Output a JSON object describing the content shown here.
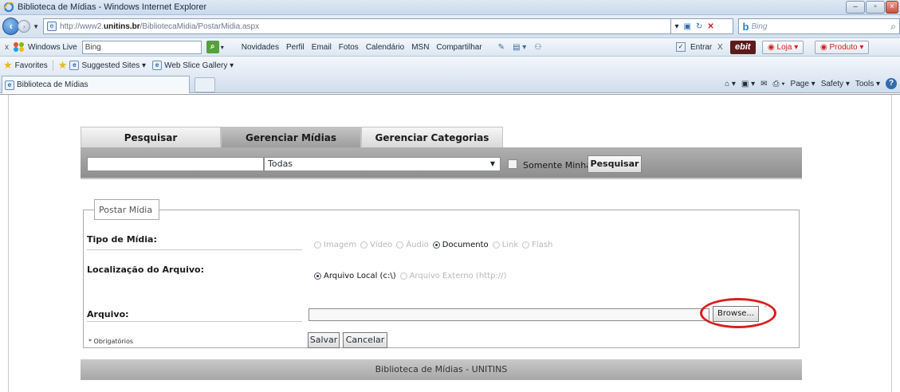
{
  "window": {
    "title": "Biblioteca de Mídias - Windows Internet Explorer"
  },
  "address": {
    "url_prefix": "http://www2.",
    "url_domain": "unitins.br",
    "url_path": "/BibliotecaMidia/PostarMidia.aspx",
    "search_placeholder": "Bing"
  },
  "live_toolbar": {
    "brand": "Windows Live",
    "search_value": "Bing",
    "links": [
      "Novidades",
      "Perfil",
      "Email",
      "Fotos",
      "Calendário",
      "MSN",
      "Compartilhar"
    ],
    "entrar": "Entrar",
    "ebit": "ebit",
    "loja": "Loja",
    "produto": "Produto"
  },
  "favorites_bar": {
    "favorites": "Favorites",
    "suggested": "Suggested Sites ▾",
    "webslice": "Web Slice Gallery ▾"
  },
  "tab": {
    "label": "Biblioteca de Mídias"
  },
  "command_bar": {
    "page": "Page ▾",
    "safety": "Safety ▾",
    "tools": "Tools ▾"
  },
  "nav_tabs": [
    {
      "label": "Pesquisar",
      "active": false
    },
    {
      "label": "Gerenciar Mídias",
      "active": true
    },
    {
      "label": "Gerenciar Categorias",
      "active": false
    }
  ],
  "filter": {
    "search_value": "",
    "category_selected": "Todas",
    "somente_minhas_label": "Somente Minhas",
    "somente_minhas_checked": false,
    "search_button": "Pesquisar"
  },
  "form": {
    "legend": "Postar Mídia",
    "tipo_label": "Tipo de Mídia:",
    "tipo_options": [
      "Imagem",
      "Vídeo",
      "Áudio",
      "Documento",
      "Link",
      "Flash"
    ],
    "tipo_selected": "Documento",
    "local_label": "Localização do Arquivo:",
    "local_options": [
      "Arquivo Local (c:\\)",
      "Arquivo Externo (http://)"
    ],
    "local_selected": "Arquivo Local (c:\\)",
    "arquivo_label": "Arquivo:",
    "arquivo_value": "",
    "browse_button": "Browse...",
    "required_note": "* Obrigatórios",
    "save_button": "Salvar",
    "cancel_button": "Cancelar"
  },
  "footer": {
    "text": "Biblioteca de Mídias - UNITINS"
  },
  "colors": {
    "annotation_ring": "#d81f1f",
    "active_tab": "#9d9d9d",
    "filter_bar": "#8e8e8e",
    "footer": "#a7a7a7"
  }
}
